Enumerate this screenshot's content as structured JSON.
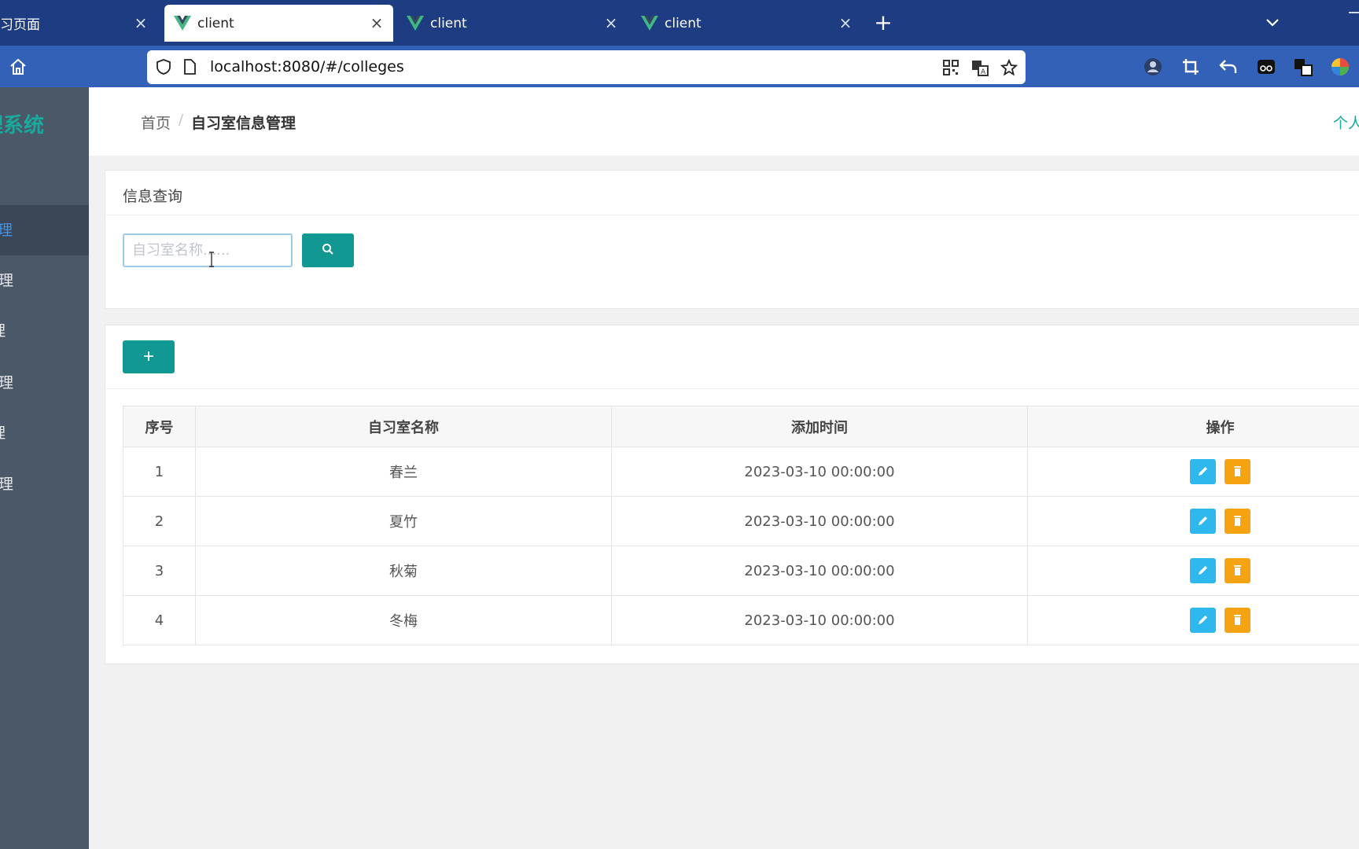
{
  "browser": {
    "tabs": [
      {
        "title": "习页面",
        "active": false
      },
      {
        "title": "client",
        "active": true
      },
      {
        "title": "client",
        "active": false
      },
      {
        "title": "client",
        "active": false
      }
    ],
    "url": "localhost:8080/#/colleges"
  },
  "sidebar": {
    "brand": "理系统",
    "items": [
      {
        "label": "​管理",
        "active": true
      },
      {
        "label": "理",
        "active": false
      },
      {
        "label": "理",
        "active": false
      },
      {
        "label": "理",
        "active": false
      },
      {
        "label": "理",
        "active": false
      },
      {
        "label": "理",
        "active": false
      }
    ]
  },
  "header": {
    "breadcrumb_home": "首页",
    "breadcrumb_sep": "/",
    "breadcrumb_current": "自习室信息管理",
    "profile": "个人"
  },
  "query": {
    "title": "信息查询",
    "search_placeholder": "自习室名称......"
  },
  "table": {
    "headers": {
      "index": "序号",
      "name": "自习室名称",
      "time": "添加时间",
      "ops": "操作"
    },
    "rows": [
      {
        "index": "1",
        "name": "春兰",
        "time": "2023-03-10 00:00:00"
      },
      {
        "index": "2",
        "name": "夏竹",
        "time": "2023-03-10 00:00:00"
      },
      {
        "index": "3",
        "name": "秋菊",
        "time": "2023-03-10 00:00:00"
      },
      {
        "index": "4",
        "name": "冬梅",
        "time": "2023-03-10 00:00:00"
      }
    ]
  },
  "buttons": {
    "add": "+"
  },
  "colors": {
    "primary": "#129892",
    "sidebar": "#4b5868",
    "edit": "#2eb8ee",
    "delete": "#f5a311",
    "browser": "#1e3c82"
  }
}
